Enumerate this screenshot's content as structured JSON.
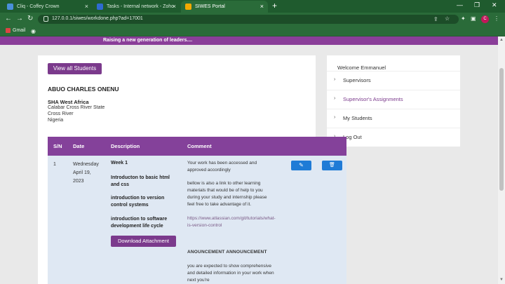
{
  "browser": {
    "tabs": [
      {
        "title": "Cliq - Coffey Crown",
        "favicon_color": "#4a90d9"
      },
      {
        "title": "Tasks - Internal network - Zoho",
        "favicon_color": "#2f6bd1"
      },
      {
        "title": "SIWES Portal",
        "favicon_color": "#f2a900"
      }
    ],
    "new_tab": "+",
    "url": "127.0.0.1/siwes/workdone.php?ad=17001",
    "bookmarks": {
      "gmail": "Gmail"
    },
    "profile_initial": "C"
  },
  "header": {
    "tagline": "Raising a new generation of leaders...."
  },
  "main": {
    "view_students_label": "View all Students",
    "student_name": "ABUO CHARLES ONENU",
    "company": "SHA West Africa",
    "address": [
      "Calabar Cross River State",
      "Cross River",
      "Nigeria"
    ]
  },
  "table": {
    "headers": {
      "sn": "S/N",
      "date": "Date",
      "description": "Description",
      "comment": "Comment"
    },
    "row": {
      "sn": "1",
      "date": [
        "Wednesday",
        "April 19,",
        "2023"
      ],
      "week": "Week 1",
      "topics": [
        [
          "Introducton to basic html",
          "and css"
        ],
        [
          "introduction to version",
          "control systems"
        ],
        [
          "introduction to software",
          "development life cycle"
        ]
      ],
      "download_label": "Download Attachment",
      "comment_lines": [
        "Your work has been accessed and",
        "approved accordingly",
        "bellow is also a link to other learning",
        "materials that would be of help to you",
        "during your study and internship please",
        "feel free to take advantage of it.",
        "https://www.atlassian.com/git/tutorials/what-",
        "is-version-control",
        "ANOUNCEMENT ANNOUNCEMENT",
        "you are expected to show comprehensive",
        "and detailed information in your work when",
        "next you're"
      ],
      "edit_icon": "✎",
      "delete_icon": "🗑"
    }
  },
  "sidebar": {
    "welcome": "Welcome Emmanuel",
    "items": [
      {
        "label": "Supervisors"
      },
      {
        "label": "Supervisor's Assignments"
      },
      {
        "label": "My Students"
      },
      {
        "label": "Log Out"
      }
    ]
  },
  "colors": {
    "brand_purple": "#84419a",
    "browser_green": "#2a6b39",
    "action_blue": "#1f7bd6"
  }
}
